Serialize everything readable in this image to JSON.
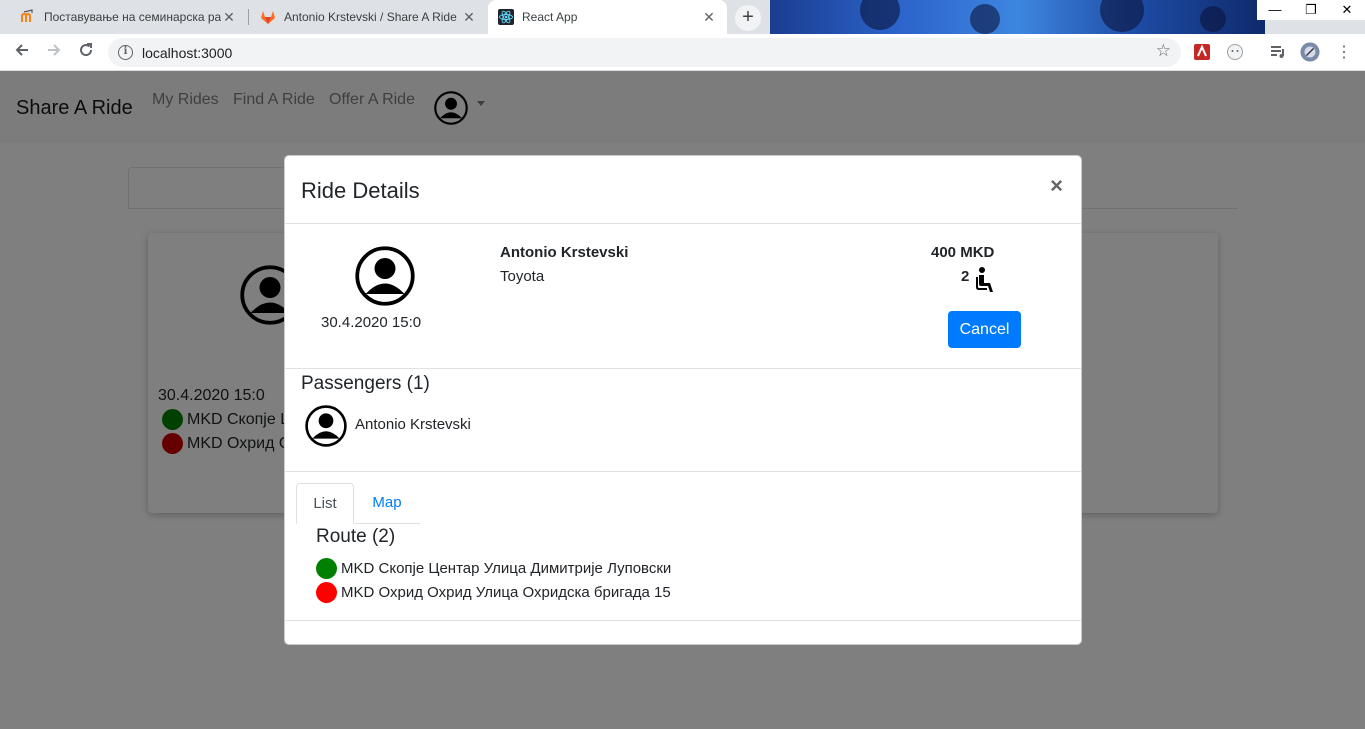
{
  "browser": {
    "tabs": [
      {
        "title": "Поставување на семинарска ра",
        "favicon": "moodle-icon",
        "active": false
      },
      {
        "title": "Antonio Krstevski / Share A Ride",
        "favicon": "gitlab-icon",
        "active": false
      },
      {
        "title": "React App",
        "favicon": "react-icon",
        "active": true
      }
    ],
    "new_tab_label": "+",
    "close_label": "✕",
    "url": "localhost:3000",
    "window_controls": {
      "minimize": "—",
      "maximize": "❐",
      "close": "✕"
    }
  },
  "app": {
    "brand": "Share A Ride",
    "nav": [
      "My Rides",
      "Find A Ride",
      "Offer A Ride"
    ],
    "background_card": {
      "date": "30.4.2020 15:0",
      "stops": [
        {
          "text": "MKD Скопје Ц",
          "color": "#008000"
        },
        {
          "text": "MKD Охрид О",
          "color": "#cc0000"
        }
      ]
    }
  },
  "modal": {
    "title": "Ride Details",
    "close_label": "×",
    "driver": {
      "name": "Antonio Krstevski",
      "car": "Toyota",
      "date": "30.4.2020 15:0",
      "price": "400 MKD",
      "seats": "2"
    },
    "cancel_label": "Cancel",
    "passengers": {
      "title": "Passengers (1)",
      "list": [
        "Antonio Krstevski"
      ]
    },
    "tabs": [
      "List",
      "Map"
    ],
    "route": {
      "title": "Route (2)",
      "stops": [
        {
          "text": "MKD Скопје Центар Улица Димитрије Луповски",
          "color": "#008000"
        },
        {
          "text": "MKD Охрид Охрид Улица Охридска бригада 15",
          "color": "#ff0000"
        }
      ]
    }
  },
  "colors": {
    "primary": "#007bff",
    "start_stop": "#008000",
    "end_stop": "#ff0000"
  }
}
